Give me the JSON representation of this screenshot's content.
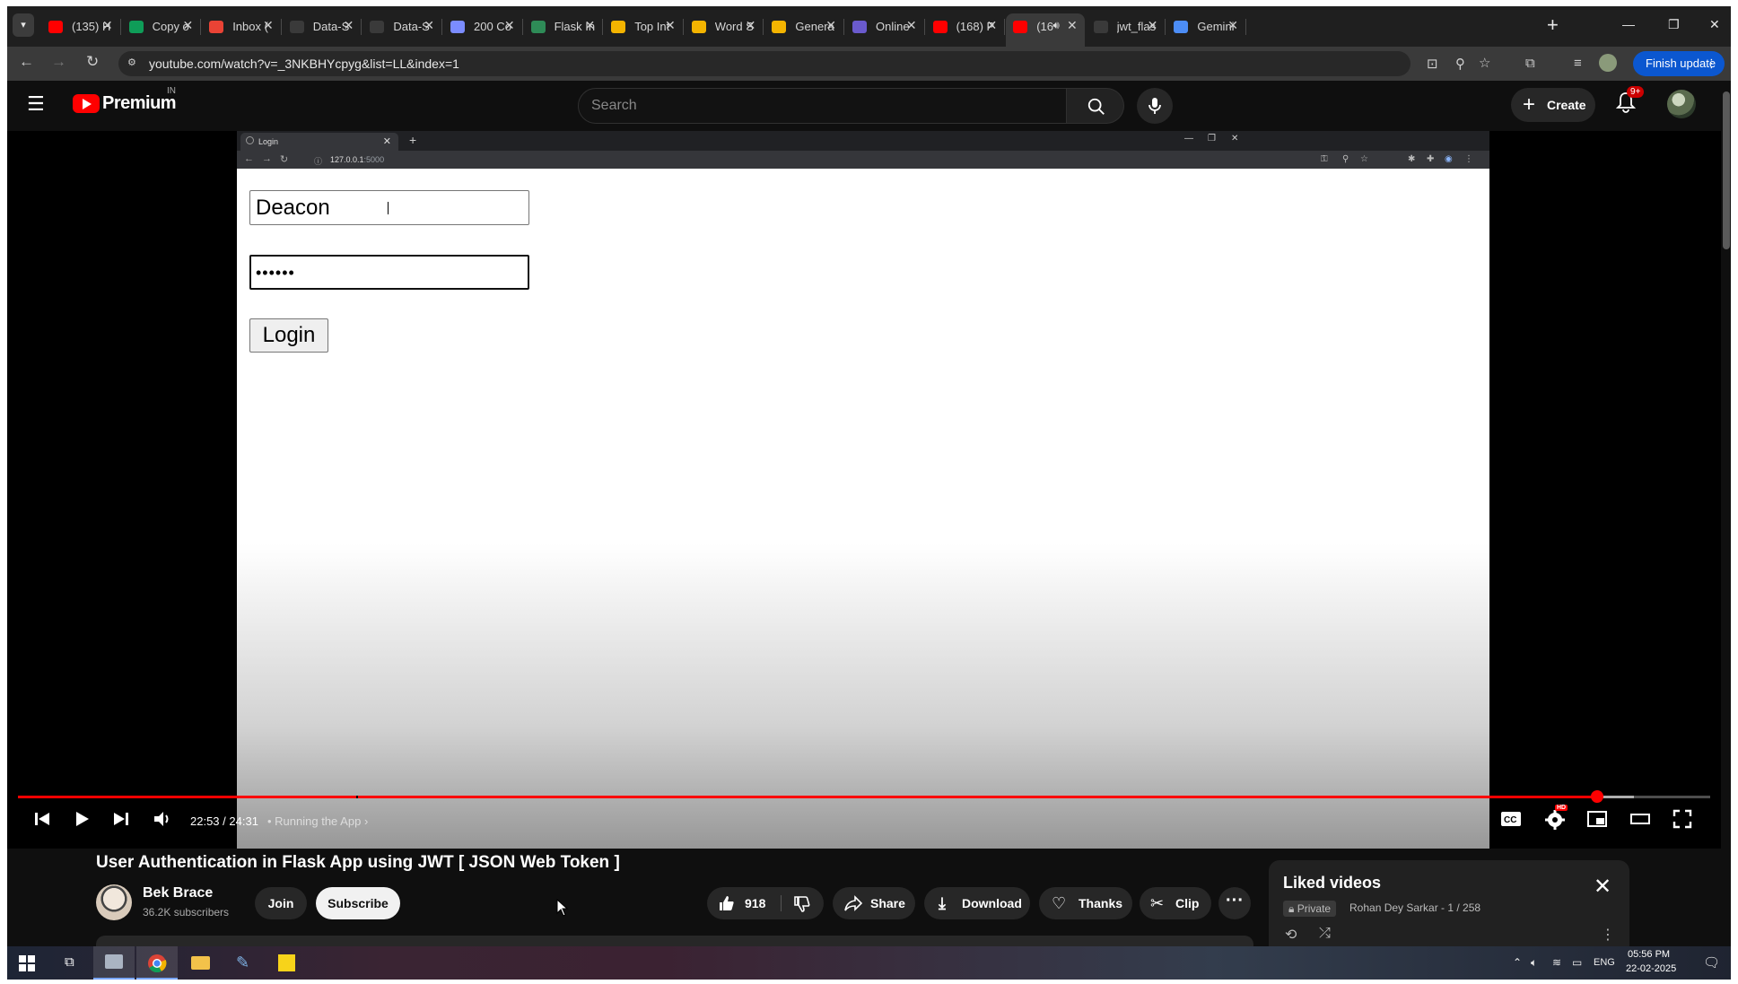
{
  "browser": {
    "tabs": [
      {
        "title": "(135) H",
        "favicon_color": "#ff0000"
      },
      {
        "title": "Copy o",
        "favicon_color": "#0f9d58"
      },
      {
        "title": "Inbox (",
        "favicon_color": "#ea4335"
      },
      {
        "title": "Data-S",
        "favicon_color": "#3a3a3a"
      },
      {
        "title": "Data-S",
        "favicon_color": "#3a3a3a"
      },
      {
        "title": "200 Co",
        "favicon_color": "#7b8cff"
      },
      {
        "title": "Flask In",
        "favicon_color": "#2e8b57"
      },
      {
        "title": "Top Int",
        "favicon_color": "#f4b400"
      },
      {
        "title": "Word S",
        "favicon_color": "#f4b400"
      },
      {
        "title": "Genera",
        "favicon_color": "#f4b400"
      },
      {
        "title": "Online",
        "favicon_color": "#6a5acd"
      },
      {
        "title": "(168) P",
        "favicon_color": "#ff0000"
      },
      {
        "title": "(16",
        "favicon_color": "#ff0000",
        "active": true
      },
      {
        "title": "jwt_flas",
        "favicon_color": "#3a3a3a"
      },
      {
        "title": "Gemini",
        "favicon_color": "#4c8df6"
      }
    ],
    "url": "youtube.com/watch?v=_3NKBHYcpyg&list=LL&index=1",
    "finish_update_label": "Finish update"
  },
  "youtube": {
    "brand": "Premium",
    "region": "IN",
    "search_placeholder": "Search",
    "create_label": "Create",
    "notification_count": "9+"
  },
  "video": {
    "inner_browser": {
      "tab_title": "Login",
      "url_host": "127.0.0.1",
      "url_port": ":5000"
    },
    "login_form": {
      "username_value": "Deacon",
      "password_value": "••••••",
      "login_label": "Login"
    },
    "player": {
      "time_current": "22:53",
      "time_total": "24:31",
      "chapter": "Running the App",
      "progress_played": 0.933,
      "progress_buffered": 0.955,
      "hd_badge": "HD"
    }
  },
  "details": {
    "title": "User Authentication in Flask App using JWT [ JSON Web Token ]",
    "channel_name": "Bek Brace",
    "subscribers": "36.2K subscribers",
    "join_label": "Join",
    "subscribe_label": "Subscribe",
    "like_count": "918",
    "share_label": "Share",
    "download_label": "Download",
    "thanks_label": "Thanks",
    "clip_label": "Clip"
  },
  "playlist": {
    "title": "Liked videos",
    "privacy": "Private",
    "owner_position": "Rohan Dey Sarkar - 1 / 258"
  },
  "taskbar": {
    "language": "ENG",
    "time": "05:56 PM",
    "date": "22-02-2025"
  }
}
